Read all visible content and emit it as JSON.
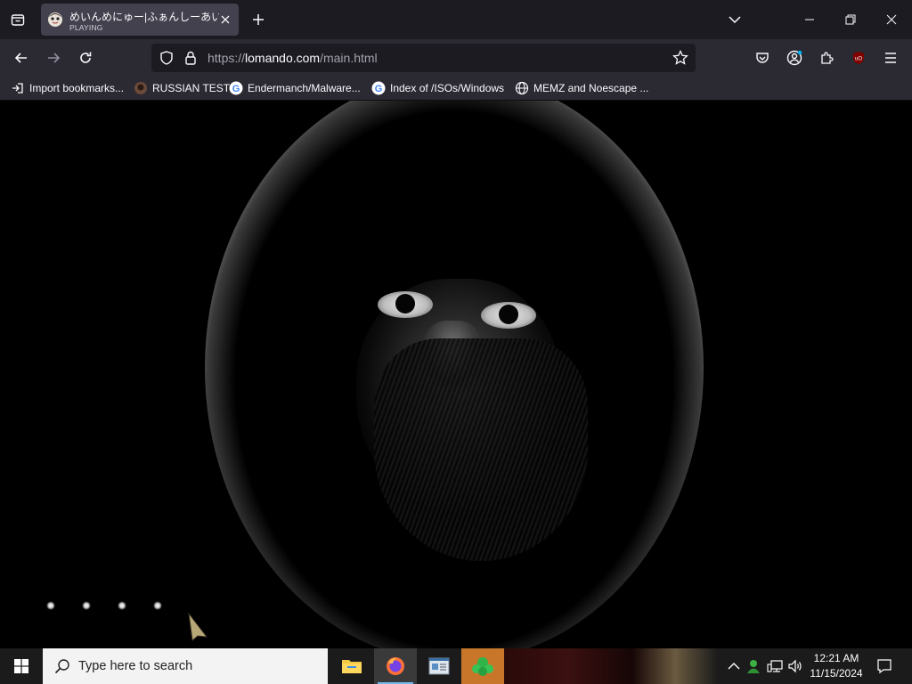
{
  "browser": {
    "tab": {
      "title": "めいんめにゅー|ふぁんしーあいろ",
      "subtitle": "PLAYING"
    },
    "url": {
      "scheme": "https://",
      "host": "lomando.com",
      "path": "/main.html"
    },
    "bookmarks": [
      {
        "label": "Import bookmarks...",
        "icon": "import-icon"
      },
      {
        "label": "RUSSIAN TEST",
        "icon": "favicon-russian-test"
      },
      {
        "label": "Endermanch/Malware...",
        "icon": "google-icon"
      },
      {
        "label": "Index of /ISOs/Windows",
        "icon": "google-icon"
      },
      {
        "label": "MEMZ and Noescape ...",
        "icon": "globe-icon"
      }
    ],
    "colors": {
      "titlebar": "#1c1b22",
      "toolbar": "#2b2a33",
      "tab_active": "#42414d"
    }
  },
  "taskbar": {
    "search_placeholder": "Type here to search",
    "apps": [
      {
        "name": "file-explorer",
        "active": false
      },
      {
        "name": "firefox",
        "active": true
      },
      {
        "name": "news-app",
        "active": false
      },
      {
        "name": "game-app",
        "active": false
      }
    ],
    "clock": {
      "time": "12:21 AM",
      "date": "11/15/2024"
    }
  }
}
